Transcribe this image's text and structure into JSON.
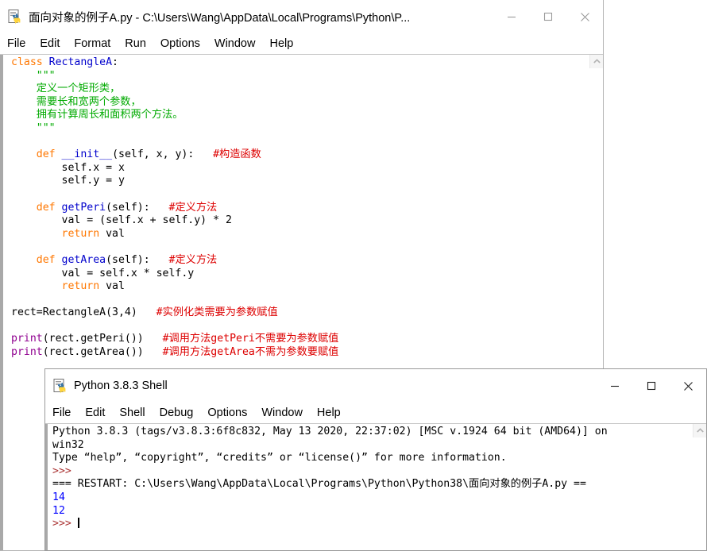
{
  "editor": {
    "title": "面向对象的例子A.py - C:\\Users\\Wang\\AppData\\Local\\Programs\\Python\\P...",
    "icon": "python-idle-icon",
    "menus": [
      "File",
      "Edit",
      "Format",
      "Run",
      "Options",
      "Window",
      "Help"
    ],
    "window_controls": {
      "minimize": "minimize-icon",
      "maximize": "maximize-icon",
      "close": "close-icon"
    },
    "code_lines": [
      [
        {
          "t": "class ",
          "c": "kw"
        },
        {
          "t": "RectangleA",
          "c": "def"
        },
        {
          "t": ":",
          "c": "plain"
        }
      ],
      [
        {
          "t": "    \"\"\"",
          "c": "str"
        }
      ],
      [
        {
          "t": "    定义一个矩形类，",
          "c": "str"
        }
      ],
      [
        {
          "t": "    需要长和宽两个参数，",
          "c": "str"
        }
      ],
      [
        {
          "t": "    拥有计算周长和面积两个方法。",
          "c": "str"
        }
      ],
      [
        {
          "t": "    \"\"\"",
          "c": "str"
        }
      ],
      [
        {
          "t": "",
          "c": "plain"
        }
      ],
      [
        {
          "t": "    def ",
          "c": "kw"
        },
        {
          "t": "__init__",
          "c": "def"
        },
        {
          "t": "(self, x, y):   ",
          "c": "plain"
        },
        {
          "t": "#构造函数",
          "c": "cmt"
        }
      ],
      [
        {
          "t": "        self.x = x",
          "c": "plain"
        }
      ],
      [
        {
          "t": "        self.y = y",
          "c": "plain"
        }
      ],
      [
        {
          "t": "",
          "c": "plain"
        }
      ],
      [
        {
          "t": "    def ",
          "c": "kw"
        },
        {
          "t": "getPeri",
          "c": "def"
        },
        {
          "t": "(self):   ",
          "c": "plain"
        },
        {
          "t": "#定义方法",
          "c": "cmt"
        }
      ],
      [
        {
          "t": "        val = (self.x + self.y) * 2",
          "c": "plain"
        }
      ],
      [
        {
          "t": "        ",
          "c": "plain"
        },
        {
          "t": "return ",
          "c": "kw"
        },
        {
          "t": "val",
          "c": "plain"
        }
      ],
      [
        {
          "t": "",
          "c": "plain"
        }
      ],
      [
        {
          "t": "    def ",
          "c": "kw"
        },
        {
          "t": "getArea",
          "c": "def"
        },
        {
          "t": "(self):   ",
          "c": "plain"
        },
        {
          "t": "#定义方法",
          "c": "cmt"
        }
      ],
      [
        {
          "t": "        val = self.x * self.y",
          "c": "plain"
        }
      ],
      [
        {
          "t": "        ",
          "c": "plain"
        },
        {
          "t": "return ",
          "c": "kw"
        },
        {
          "t": "val",
          "c": "plain"
        }
      ],
      [
        {
          "t": "",
          "c": "plain"
        }
      ],
      [
        {
          "t": "rect=RectangleA(3,4)   ",
          "c": "plain"
        },
        {
          "t": "#实例化类需要为参数赋值",
          "c": "cmt"
        }
      ],
      [
        {
          "t": "",
          "c": "plain"
        }
      ],
      [
        {
          "t": "print",
          "c": "builtin"
        },
        {
          "t": "(rect.getPeri())   ",
          "c": "plain"
        },
        {
          "t": "#调用方法getPeri不需要为参数赋值",
          "c": "cmt"
        }
      ],
      [
        {
          "t": "print",
          "c": "builtin"
        },
        {
          "t": "(rect.getArea())   ",
          "c": "plain"
        },
        {
          "t": "#调用方法getArea不需为参数要赋值",
          "c": "cmt"
        }
      ]
    ],
    "scrollbar": {
      "up_arrow": "chevron-up-icon"
    }
  },
  "shell": {
    "title": "Python 3.8.3 Shell",
    "icon": "python-idle-icon",
    "menus": [
      "File",
      "Edit",
      "Shell",
      "Debug",
      "Options",
      "Window",
      "Help"
    ],
    "window_controls": {
      "minimize": "minimize-icon",
      "maximize": "maximize-icon",
      "close": "close-icon"
    },
    "output_lines": [
      [
        {
          "t": "Python 3.8.3 (tags/v3.8.3:6f8c832, May 13 2020, 22:37:02) [MSC v.1924 64 bit (AMD64)] on",
          "c": "plain"
        }
      ],
      [
        {
          "t": "win32",
          "c": "plain"
        }
      ],
      [
        {
          "t": "Type “help”, “copyright”, “credits” or “license()” for more information.",
          "c": "plain"
        }
      ],
      [
        {
          "t": ">>> ",
          "c": "prompt"
        }
      ],
      [
        {
          "t": "=== RESTART: C:\\Users\\Wang\\AppData\\Local\\Programs\\Python\\Python38\\面向对象的例子A.py ==",
          "c": "plain"
        }
      ],
      [
        {
          "t": "14",
          "c": "outnum"
        }
      ],
      [
        {
          "t": "12",
          "c": "outnum"
        }
      ],
      [
        {
          "t": ">>> ",
          "c": "prompt"
        },
        {
          "t": "__CARET__",
          "c": "caret"
        }
      ]
    ],
    "scrollbar": {
      "up_arrow": "chevron-up-icon"
    }
  }
}
